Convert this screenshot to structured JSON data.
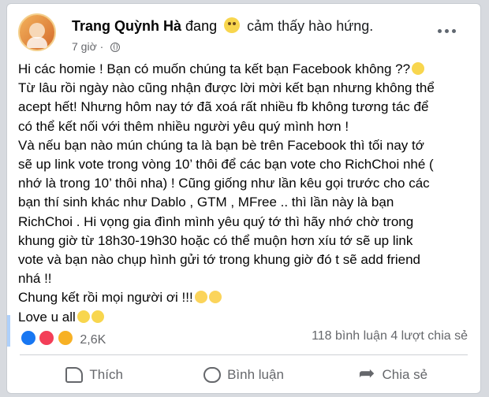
{
  "post": {
    "author": "Trang Quỳnh Hà",
    "status_before": "đang",
    "status_after": "cảm thấy hào hứng.",
    "time": "7 giờ",
    "dot": "·",
    "text_lines": [
      "Hi các homie ! Bạn có muốn chúng ta kết bạn Facebook không ??",
      "Từ lâu rồi ngày nào cũng nhận được lời mời kết bạn nhưng không thể",
      "acept hết! Nhưng hôm nay tớ đã xoá rất nhiều fb không tương tác để",
      "có thể kết nối với thêm nhiều người yêu quý mình hơn !",
      "Và nếu bạn nào mún chúng ta là bạn bè trên Facebook thì tối nay tớ",
      "sẽ up link vote trong vòng 10’ thôi để các bạn vote cho RichChoi nhé (",
      "nhớ là trong 10’ thôi nha) ! Cũng giống như lần kêu gọi trước cho các",
      "bạn thí sinh khác như Dablo , GTM , MFree .. thì lần này là bạn",
      "RichChoi . Hi vọng gia đình mình yêu quý tớ thì hãy nhớ chờ trong",
      "khung giờ từ 18h30-19h30 hoặc có thể muộn hơn xíu tớ sẽ up link",
      "vote và bạn nào chụp hình gửi tớ trong khung giờ đó t sẽ add friend",
      "nhá !!",
      "Chung kết rồi mọi người ơi !!!",
      "Love u all"
    ]
  },
  "engagement": {
    "reaction_count": "2,6K",
    "comments": "118 bình luận",
    "shares": "4 lượt chia sẻ"
  },
  "actions": {
    "like": "Thích",
    "comment": "Bình luận",
    "share": "Chia sẻ"
  },
  "colors": {
    "facebook_blue": "#1877f2",
    "text": "#050505",
    "secondary_text": "#65676b"
  },
  "icons": [
    "more-options-icon",
    "globe-icon",
    "like-icon",
    "comment-icon",
    "share-icon"
  ]
}
